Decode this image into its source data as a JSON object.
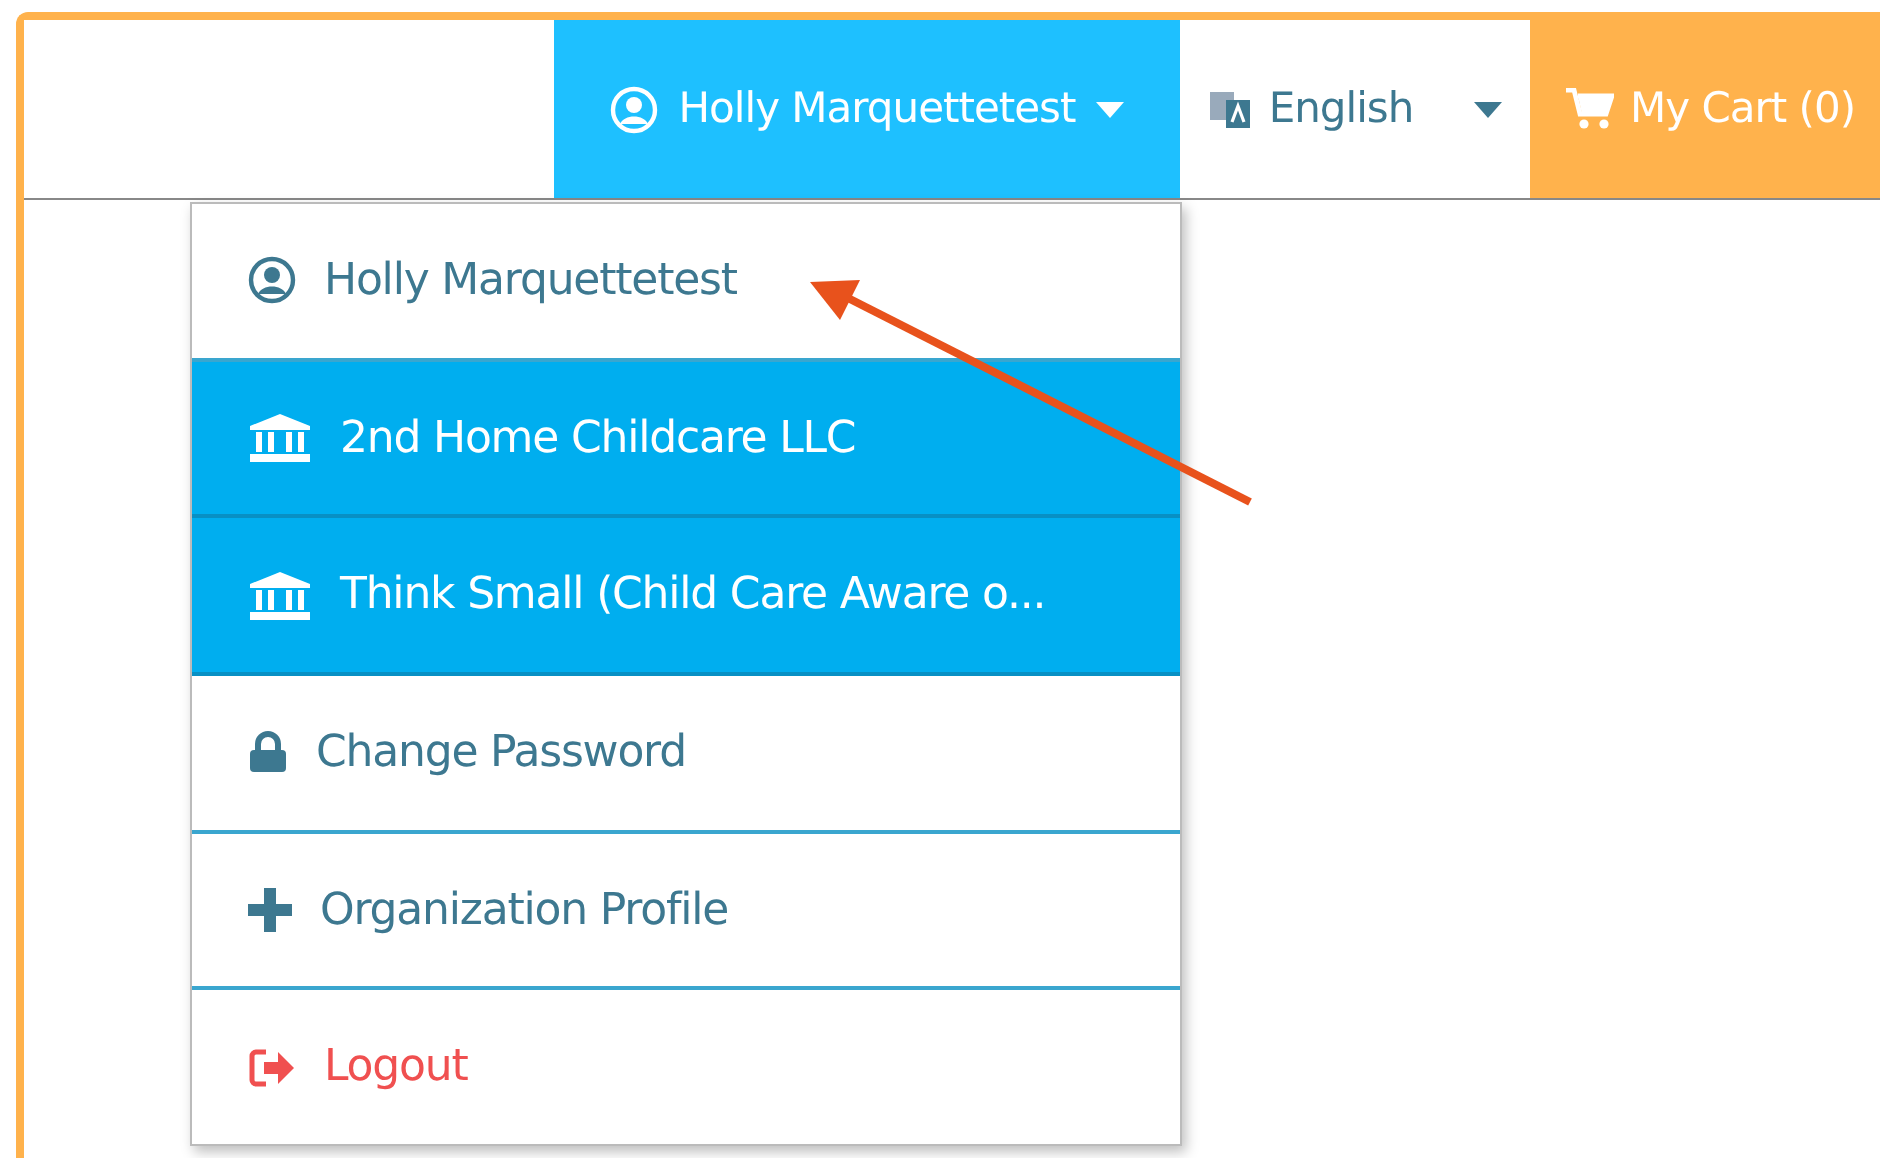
{
  "navbar": {
    "user_menu": {
      "label": "Holly Marquettetest",
      "expanded": true
    },
    "language": {
      "label": "English"
    },
    "cart": {
      "label": "My Cart (0)"
    }
  },
  "dropdown": {
    "items": [
      {
        "kind": "user",
        "label": "Holly Marquettetest",
        "selected": false
      },
      {
        "kind": "organization",
        "label": "2nd Home Childcare LLC",
        "selected": true
      },
      {
        "kind": "organization",
        "label": "Think Small (Child Care Aware o...",
        "selected": true
      },
      {
        "kind": "password",
        "label": "Change Password",
        "selected": false
      },
      {
        "kind": "profile",
        "label": "Organization Profile",
        "selected": false
      },
      {
        "kind": "logout",
        "label": "Logout",
        "selected": false
      }
    ]
  }
}
